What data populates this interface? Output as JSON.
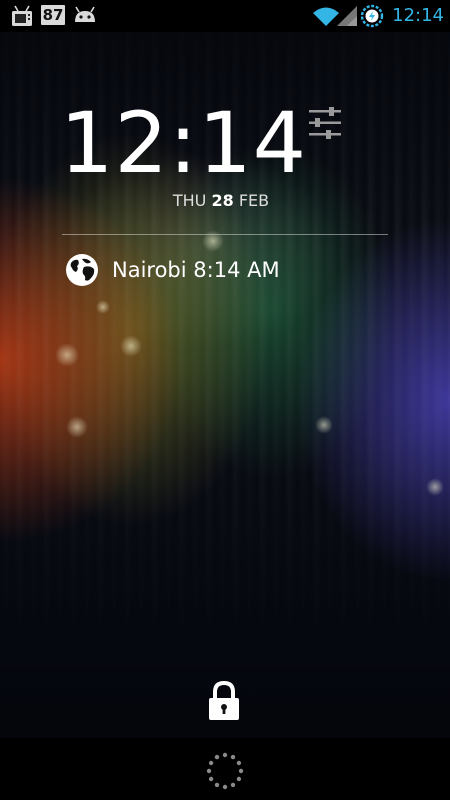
{
  "status_bar": {
    "notification_badge": "87",
    "time": "12:14",
    "icons": [
      "tv-notification-icon",
      "android-notification-icon",
      "wifi-icon",
      "signal-icon",
      "battery-charging-icon"
    ],
    "accent_color": "#33b5e5"
  },
  "lockscreen": {
    "clock_hours": "12",
    "clock_separator": ":",
    "clock_minutes": "14",
    "date_weekday": "THU",
    "date_day": "28",
    "date_month": "FEB",
    "world_clock": {
      "city": "Nairobi",
      "time": "8:14 AM",
      "icon": "globe-icon"
    },
    "settings_icon": "settings-sliders-icon",
    "lock_icon": "lock-icon",
    "bottom_icon": "spinner-icon"
  }
}
